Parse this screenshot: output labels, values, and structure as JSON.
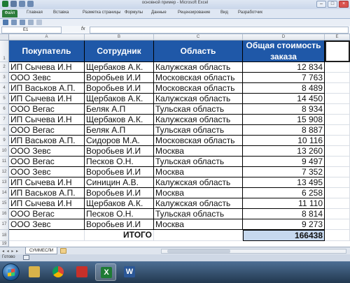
{
  "window": {
    "title": "основной пример - Microsoft Excel"
  },
  "ribbon": {
    "tabs": [
      "Файл",
      "Главная",
      "Вставка",
      "Разметка страницы",
      "Формулы",
      "Данные",
      "Рецензирование",
      "Вид",
      "Разработчик"
    ]
  },
  "formula_bar": {
    "name_box": "E1",
    "fx": "fx",
    "value": ""
  },
  "sheet": {
    "columns": [
      "A",
      "B",
      "C",
      "D",
      "E"
    ],
    "headers": [
      "Покупатель",
      "Сотрудник",
      "Область",
      "Общая стоимость заказа"
    ],
    "rows": [
      {
        "num": "2",
        "buyer": "ИП Сычева И.Н",
        "employee": "Щербаков А.К.",
        "region": "Калужская область",
        "total": "12 834"
      },
      {
        "num": "3",
        "buyer": "ООО Зевс",
        "employee": "Воробьев И.И",
        "region": "Московская область",
        "total": "7 763"
      },
      {
        "num": "4",
        "buyer": "ИП Васьков А.П.",
        "employee": "Воробьев И.И",
        "region": "Московская область",
        "total": "8 489"
      },
      {
        "num": "5",
        "buyer": "ИП Сычева И.Н",
        "employee": "Щербаков А.К.",
        "region": "Калужская область",
        "total": "14 450"
      },
      {
        "num": "6",
        "buyer": "ООО Вегас",
        "employee": "Беляк А.П",
        "region": "Тульская область",
        "total": "8 934"
      },
      {
        "num": "7",
        "buyer": "ИП Сычева И.Н",
        "employee": "Щербаков А.К.",
        "region": "Калужская область",
        "total": "15 908"
      },
      {
        "num": "8",
        "buyer": "ООО Вегас",
        "employee": "Беляк А.П",
        "region": "Тульская область",
        "total": "8 887"
      },
      {
        "num": "9",
        "buyer": "ИП Васьков А.П.",
        "employee": "Сидоров М.А.",
        "region": "Московская область",
        "total": "10 116"
      },
      {
        "num": "10",
        "buyer": "ООО Зевс",
        "employee": "Воробьев И.И",
        "region": "Москва",
        "total": "13 260"
      },
      {
        "num": "11",
        "buyer": "ООО Вегас",
        "employee": "Песков О.Н.",
        "region": "Тульская область",
        "total": "9 497"
      },
      {
        "num": "12",
        "buyer": "ООО Зевс",
        "employee": "Воробьев И.И",
        "region": "Москва",
        "total": "7 352"
      },
      {
        "num": "13",
        "buyer": "ИП Сычева И.Н",
        "employee": "Синицин А.В.",
        "region": "Калужская область",
        "total": "13 495"
      },
      {
        "num": "14",
        "buyer": "ИП Васьков А.П.",
        "employee": "Воробьев И.И",
        "region": "Москва",
        "total": "6 258"
      },
      {
        "num": "15",
        "buyer": "ИП Сычева И.Н",
        "employee": "Щербаков А.К.",
        "region": "Калужская область",
        "total": "11 110"
      },
      {
        "num": "16",
        "buyer": "ООО Вегас",
        "employee": "Песков О.Н.",
        "region": "Тульская область",
        "total": "8 814"
      },
      {
        "num": "17",
        "buyer": "ООО Зевс",
        "employee": "Воробьев И.И",
        "region": "Москва",
        "total": "9 273"
      }
    ],
    "total_row_num": "18",
    "total_label": "ИТОГО",
    "total_value": "166438",
    "extra_row_nums": [
      "19",
      "20"
    ]
  },
  "sheet_tabs": {
    "nav": "◂ ◂ ▸ ▸",
    "active_tab": "СУММЕСЛИ"
  },
  "status": {
    "text": "Готово"
  },
  "taskbar": {
    "excel_glyph": "X",
    "word_glyph": "W"
  }
}
